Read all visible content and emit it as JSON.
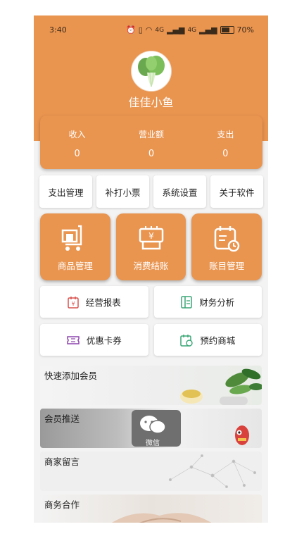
{
  "status_bar": {
    "time": "3:40",
    "signal_1": "4G",
    "signal_2": "4G",
    "battery": "70%"
  },
  "profile": {
    "name": "佳佳小鱼"
  },
  "stats": [
    {
      "label": "收入",
      "value": "0"
    },
    {
      "label": "营业额",
      "value": "0"
    },
    {
      "label": "支出",
      "value": "0"
    }
  ],
  "quick_buttons": [
    {
      "label": "支出管理"
    },
    {
      "label": "补打小票"
    },
    {
      "label": "系统设置"
    },
    {
      "label": "关于软件"
    }
  ],
  "main_tiles": [
    {
      "label": "商品管理",
      "icon": "cart-icon"
    },
    {
      "label": "消费结账",
      "icon": "cash-register-icon"
    },
    {
      "label": "账目管理",
      "icon": "calendar-clock-icon"
    }
  ],
  "feature_buttons": [
    {
      "label": "经营报表",
      "icon": "report-icon",
      "color": "#d9534f"
    },
    {
      "label": "财务分析",
      "icon": "analysis-icon",
      "color": "#3aa676"
    },
    {
      "label": "优惠卡券",
      "icon": "coupon-icon",
      "color": "#8e44ad"
    },
    {
      "label": "预约商城",
      "icon": "booking-icon",
      "color": "#3aa676"
    }
  ],
  "banners": [
    {
      "title": "快速添加会员"
    },
    {
      "title": "会员推送",
      "caption": "微信"
    },
    {
      "title": "商家留言"
    },
    {
      "title": "商务合作"
    }
  ],
  "theme": {
    "accent": "#e9944f",
    "background": "#f3f3f3"
  }
}
